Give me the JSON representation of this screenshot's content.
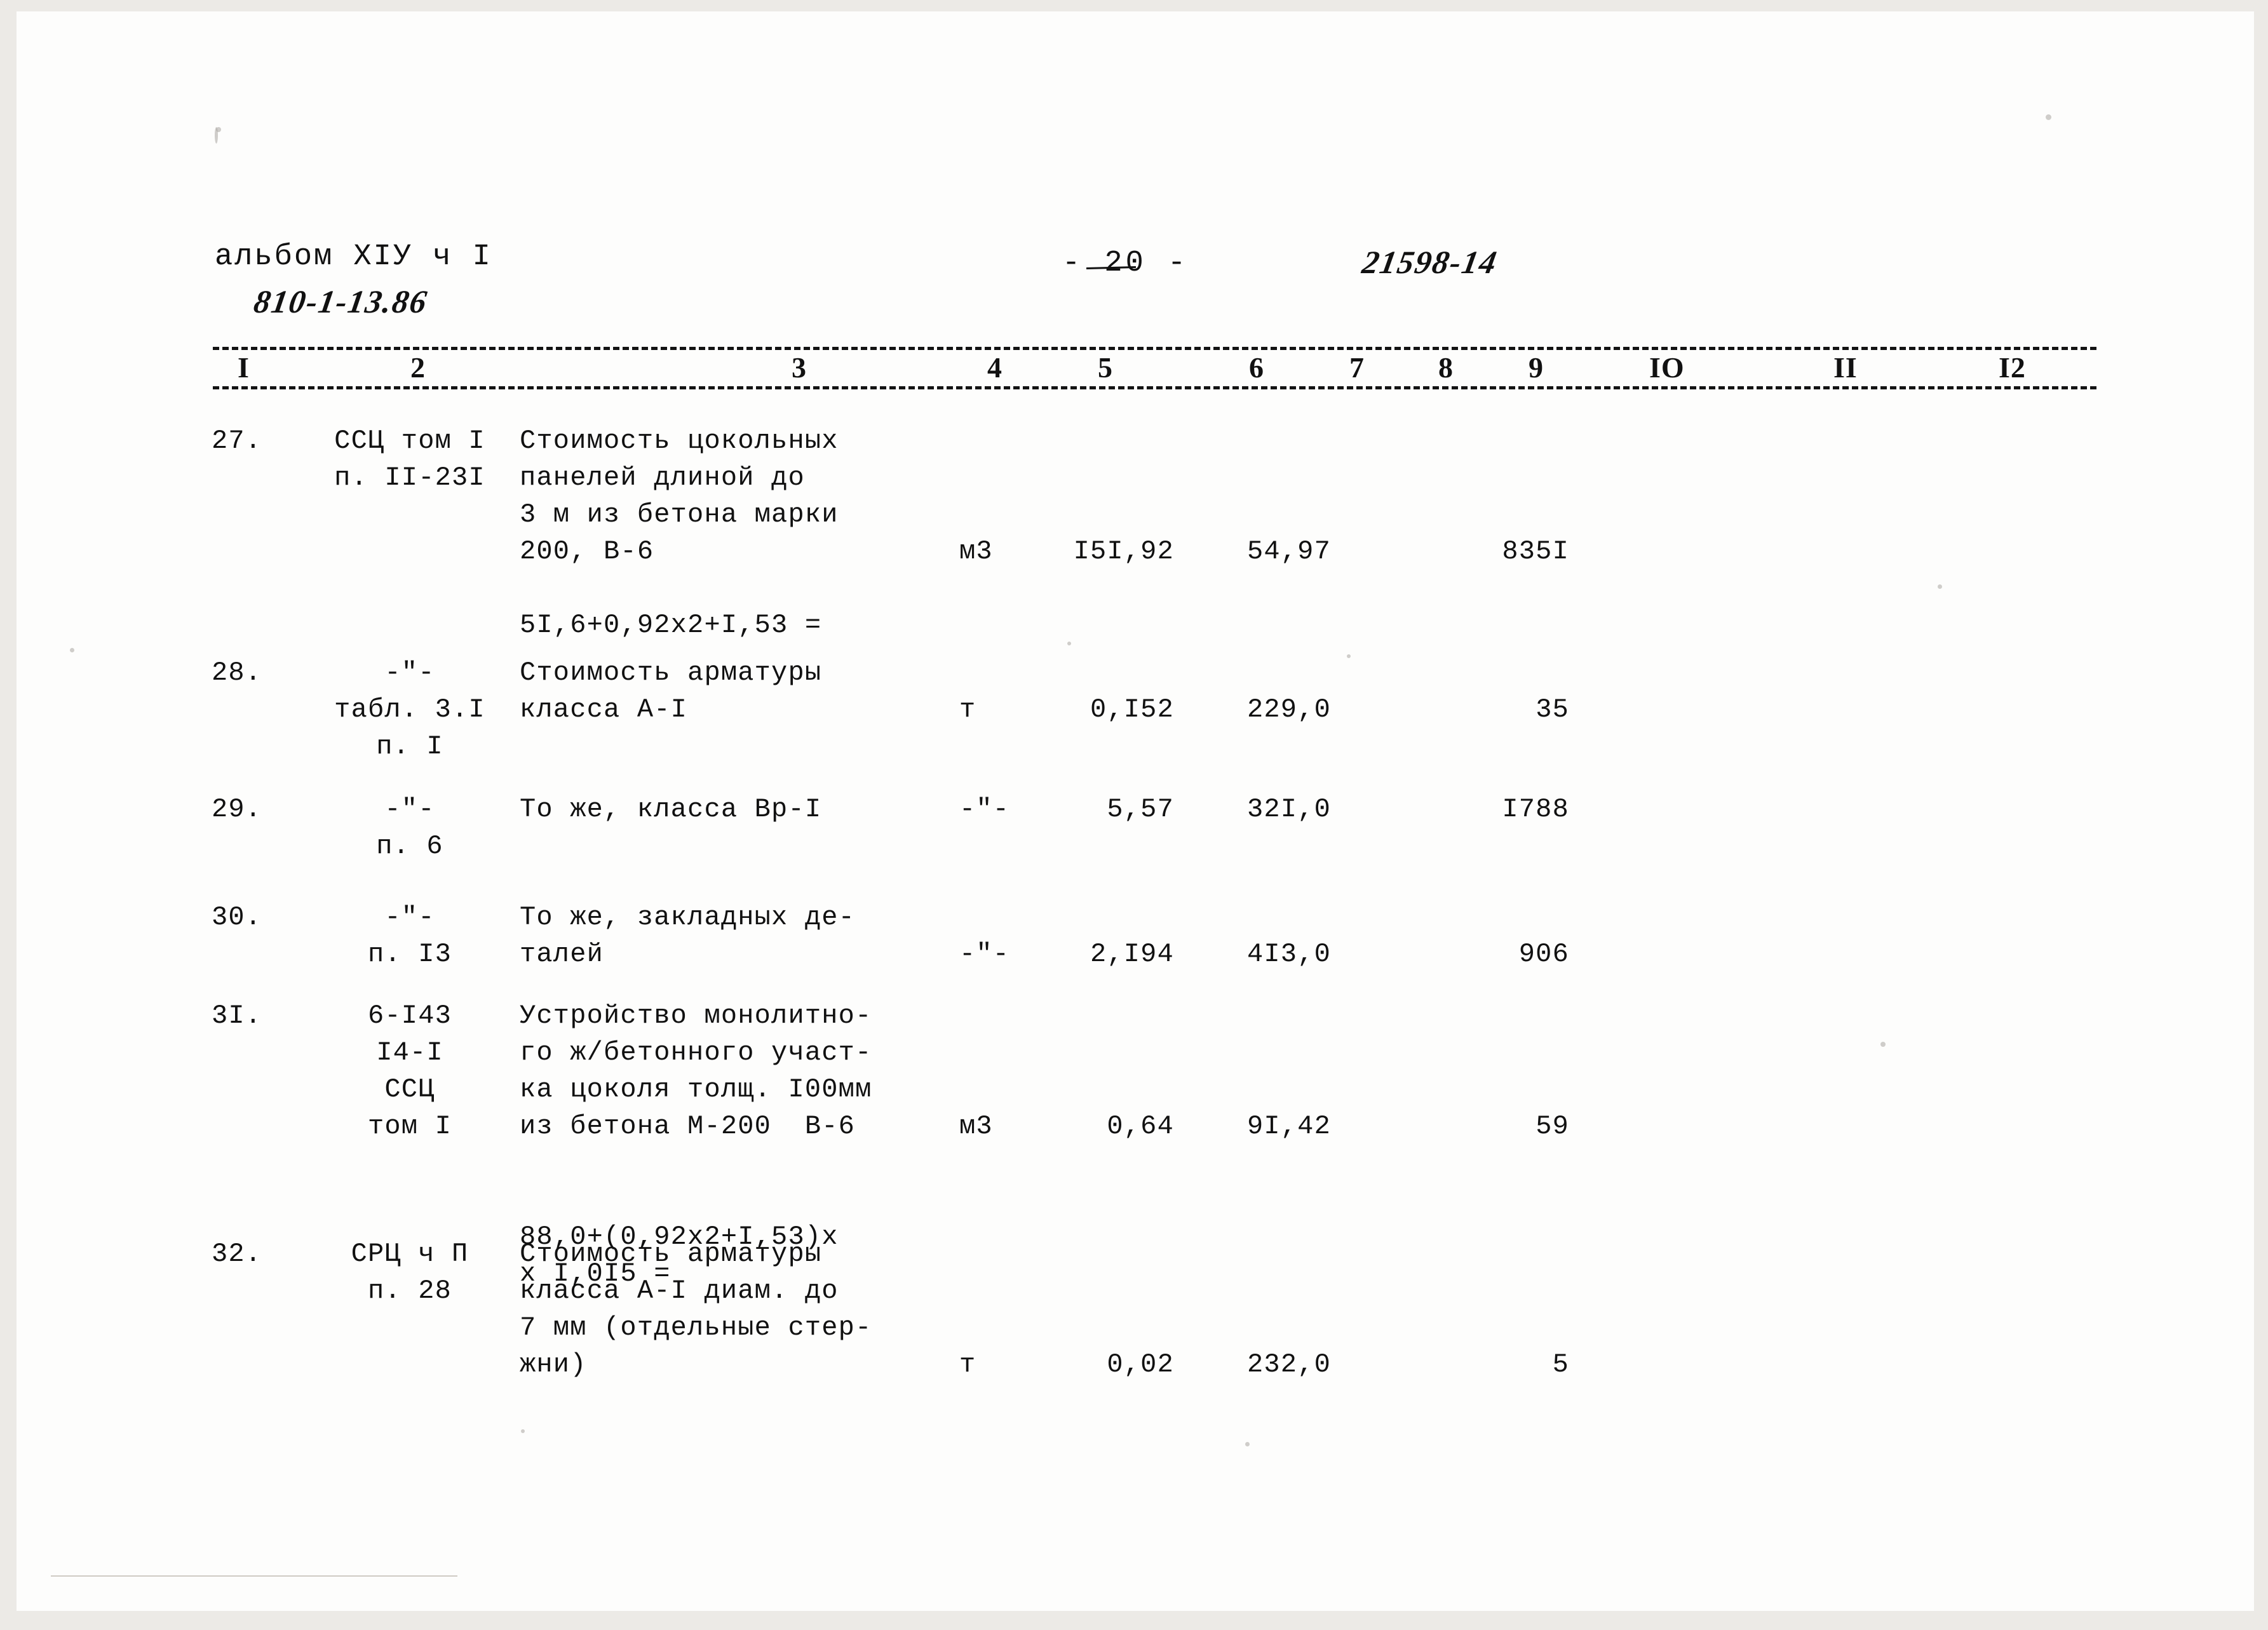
{
  "header": {
    "album": "альбом XIУ ч  I",
    "code": "810-1-13.86",
    "page_number": "- 20 -",
    "stamp": "21598-14"
  },
  "table": {
    "column_numbers": [
      "I",
      "2",
      "3",
      "4",
      "5",
      "6",
      "7",
      "8",
      "9",
      "IO",
      "II",
      "I2"
    ],
    "rows": [
      {
        "num": "27.",
        "justification": [
          "ССЦ том I",
          "п. II-23I"
        ],
        "name": [
          "Стоимость цокольных",
          "панелей длиной до",
          "3 м из бетона марки",
          "200, В-6"
        ],
        "unit": "м3",
        "quantity": "I5I,92",
        "price": "54,97",
        "sum": "835I",
        "calc": [
          "5I,6+0,92х2+I,53 ="
        ]
      },
      {
        "num": "28.",
        "justification": [
          "-\"-",
          "табл. 3.I",
          "п. I"
        ],
        "name": [
          "Стоимость арматуры",
          "класса А-I"
        ],
        "unit": "т",
        "quantity": "0,I52",
        "price": "229,0",
        "sum": "35",
        "calc": []
      },
      {
        "num": "29.",
        "justification": [
          "-\"-",
          "п. 6"
        ],
        "name": [
          "То же, класса Вр-I"
        ],
        "unit": "-\"-",
        "quantity": "5,57",
        "price": "32I,0",
        "sum": "I788",
        "calc": []
      },
      {
        "num": "30.",
        "justification": [
          "-\"-",
          "п. I3"
        ],
        "name": [
          "То же, закладных де-",
          "талей"
        ],
        "unit": "-\"-",
        "quantity": "2,I94",
        "price": "4I3,0",
        "sum": "906",
        "calc": []
      },
      {
        "num": "3I.",
        "justification": [
          "6-I43",
          "I4-I",
          "ССЦ",
          "том I"
        ],
        "name": [
          "Устройство монолитно-",
          "го ж/бетонного участ-",
          "ка цоколя толщ. I00мм",
          "из бетона М-200  В-6"
        ],
        "unit": "м3",
        "quantity": "0,64",
        "price": "9I,42",
        "sum": "59",
        "calc": [
          "88,0+(0,92х2+I,53)х",
          "х I,0I5 ="
        ]
      },
      {
        "num": "32.",
        "justification": [
          "СРЦ ч П",
          "п. 28"
        ],
        "name": [
          "Стоимость арматуры",
          "класса А-I диам. до",
          "7 мм (отдельные стер-",
          "жни)"
        ],
        "unit": "т",
        "quantity": "0,02",
        "price": "232,0",
        "sum": "5",
        "calc": []
      }
    ]
  }
}
